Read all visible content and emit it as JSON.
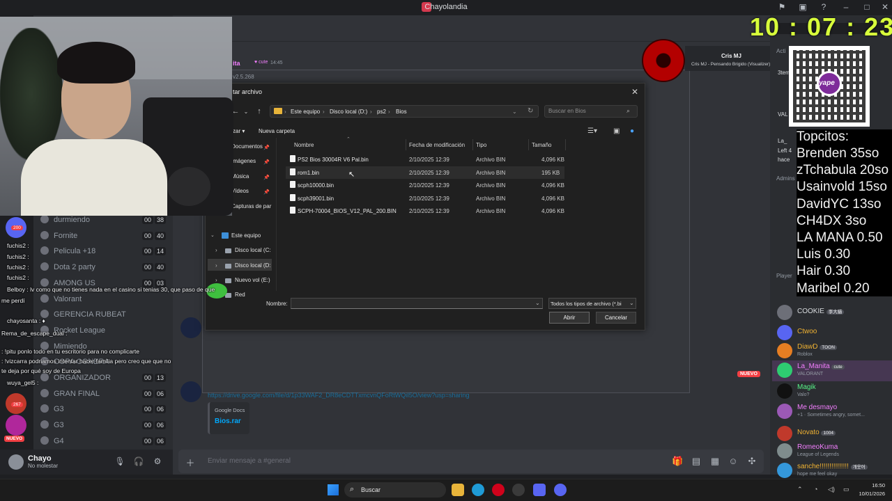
{
  "titlebar": {
    "title": "Chayolandia"
  },
  "stream_clock": "10 : 07 : 23",
  "channels": [
    {
      "label": "durmiendo",
      "a": "00",
      "b": "38"
    },
    {
      "label": "Fornite",
      "a": "00",
      "b": "40"
    },
    {
      "label": "Pelicula +18",
      "a": "00",
      "b": "14"
    },
    {
      "label": "Dota 2 party",
      "a": "00",
      "b": "40"
    },
    {
      "label": "AMONG US",
      "a": "00",
      "b": "03"
    },
    {
      "label": "Valorant",
      "a": "",
      "b": ""
    },
    {
      "label": "GERENCIA RUBEAT",
      "a": "",
      "b": ""
    },
    {
      "label": "Rocket League",
      "a": "",
      "b": ""
    },
    {
      "label": "Mimiendo",
      "a": "",
      "b": ""
    },
    {
      "label": "COPA CONERA",
      "a": "",
      "b": ""
    },
    {
      "label": "ORGANIZADOR",
      "a": "00",
      "b": "13"
    },
    {
      "label": "GRAN FINAL",
      "a": "00",
      "b": "06"
    },
    {
      "label": "G3",
      "a": "00",
      "b": "06"
    },
    {
      "label": "G3",
      "a": "00",
      "b": "06"
    },
    {
      "label": "G4",
      "a": "00",
      "b": "06"
    }
  ],
  "server_badges": {
    "count_200": "200",
    "count_267": "267",
    "nuevo": "NUEVO"
  },
  "chat_overlay": [
    {
      "user": "fuchis2",
      "text": "fuchis2 :"
    },
    {
      "user": "fuchis2",
      "text": "fuchis2 :"
    },
    {
      "user": "fuchis2",
      "text": "fuchis2 :"
    },
    {
      "user": "fuchis2",
      "text": "fuchis2 :"
    },
    {
      "user": "Belboy",
      "text": "Belboy : lv como que no tienes nada en el casino si tenias 30, que paso de que"
    },
    {
      "user": "",
      "text": "me perdí"
    },
    {
      "user": "chayosanta",
      "text": "chayosanta : ♦"
    },
    {
      "user": "",
      "text": "Rema_de_escape_dual :"
    },
    {
      "user": "",
      "text": ": !pitu ponlo todo en tu escritorio para no complicarte"
    },
    {
      "user": "",
      "text": ": !vizcarra podriamos intentar hacer familia pero creo que que no"
    },
    {
      "user": "",
      "text": "te deja por qué soy de Europa"
    },
    {
      "user": "wuya_gel5",
      "text": "wuya_gel5 :"
    }
  ],
  "user_area": {
    "name": "Chayo",
    "status": "No molestar"
  },
  "message_box": {
    "placeholder": "Enviar mensaje a #general"
  },
  "message": {
    "user": "ita",
    "tag": "cute",
    "time": "14:45",
    "link": "https://drive.google.com/file/d/1p33WAF2_DR8eCDTTxmcvnQFoRtWQiI5O/view?usp=sharing",
    "embed_provider": "Google Docs",
    "embed_title": "Bios.rar",
    "new_badge": "NUEVO"
  },
  "bg_modal": {
    "version": "v2.5.268"
  },
  "now_playing": {
    "title": "Cris MJ",
    "subtitle": "Cris MJ - Pensando Brigido (Visualizer)"
  },
  "dialog": {
    "title": "tar archivo",
    "breadcrumb": [
      "Este equipo",
      "Disco local (D:)",
      "ps2",
      "Bios"
    ],
    "search_placeholder": "Buscar en Bios",
    "toolbar": {
      "organize": "zar",
      "new_folder": "Nueva carpeta"
    },
    "nav_items": [
      "Documentos",
      "Imágenes",
      "Música",
      "Vídeos",
      "Capturas de par"
    ],
    "tree": [
      "Este equipo",
      "Disco local (C:",
      "Disco local (D:",
      "Nuevo vol (E:)",
      "Red"
    ],
    "columns": {
      "name": "Nombre",
      "modified": "Fecha de modificación",
      "type": "Tipo",
      "size": "Tamaño"
    },
    "files": [
      {
        "name": "PS2 Bios 30004R V6 Pal.bin",
        "modified": "2/10/2025 12:39",
        "type": "Archivo BIN",
        "size": "4,096 KB"
      },
      {
        "name": "rom1.bin",
        "modified": "2/10/2025 12:39",
        "type": "Archivo BIN",
        "size": "195 KB"
      },
      {
        "name": "scph10000.bin",
        "modified": "2/10/2025 12:39",
        "type": "Archivo BIN",
        "size": "4,096 KB"
      },
      {
        "name": "scph39001.bin",
        "modified": "2/10/2025 12:39",
        "type": "Archivo BIN",
        "size": "4,096 KB"
      },
      {
        "name": "SCPH-70004_BIOS_V12_PAL_200.BIN",
        "modified": "2/10/2025 12:39",
        "type": "Archivo BIN",
        "size": "4,096 KB"
      }
    ],
    "name_label": "Nombre:",
    "name_value": "",
    "filetype": "Todos los tipos de archivo (*.bi",
    "open_label": "Abrir",
    "cancel_label": "Cancelar"
  },
  "topcitos": {
    "header": "Topcitos:",
    "lines": [
      "Brenden 35so",
      "zTchabula 20so",
      "Usainvold 15so",
      "DavidYC 13so",
      "CH4DX 3so",
      "LA MANA 0.50",
      "Luis 0.30",
      "Hair 0.30",
      "Maribel 0.20"
    ]
  },
  "members": {
    "headers": {
      "active": "Acti",
      "admins": "Admins",
      "player": "Player"
    },
    "list": [
      {
        "name": "COOKIE",
        "sub": "",
        "badge": "李大貓",
        "color": "#dbdee1"
      },
      {
        "name": "Ctwoo",
        "sub": "",
        "badge": "",
        "color": "#f0b232"
      },
      {
        "name": "DiawD",
        "sub": "Roblox",
        "badge": "TOON",
        "color": "#f0b232"
      },
      {
        "name": "La_Manita",
        "sub": "VALORANT",
        "badge": "cute",
        "color": "#f47fff"
      },
      {
        "name": "Magik",
        "sub": "Valo?",
        "badge": "",
        "color": "#57f287"
      },
      {
        "name": "Me desmayo",
        "sub": "+1 · Sometimes angry, somet...",
        "badge": "",
        "color": "#f47fff"
      },
      {
        "name": "Novato",
        "sub": "",
        "badge": "1004",
        "color": "#f0b232"
      },
      {
        "name": "RomeoKuma",
        "sub": "League of Legends",
        "badge": "",
        "color": "#f47fff"
      },
      {
        "name": "sanche!!!!!!!!!!!!!!!",
        "sub": "hope me feel okay",
        "badge": "개웃어",
        "color": "#f0b232"
      }
    ],
    "partial": [
      "3tem",
      "VAL",
      "La_",
      "Left 4",
      "hace"
    ]
  },
  "taskbar": {
    "search_label": "Buscar",
    "time": "16:50",
    "date": "10/01/2026"
  },
  "colors": {
    "accent_clock": "#d8ff3b",
    "discord_bg": "#313338",
    "new_badge": "#f23f43"
  }
}
